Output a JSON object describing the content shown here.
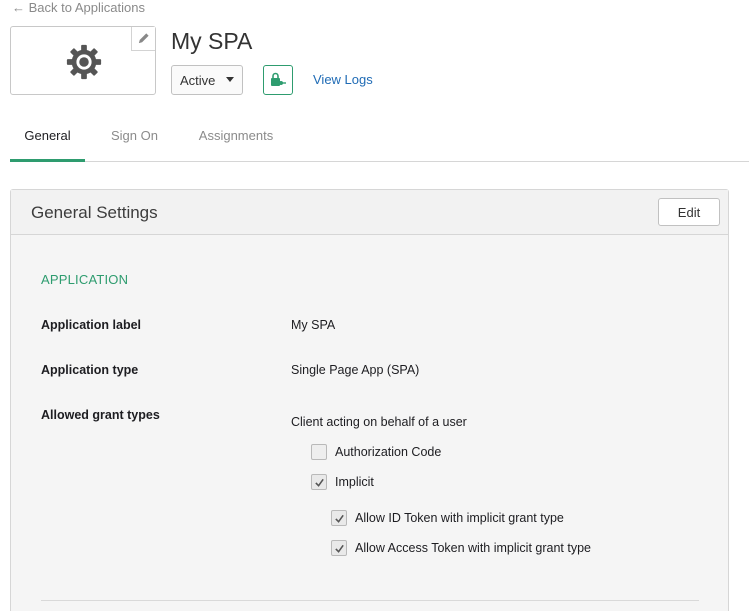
{
  "nav": {
    "back_label": "← Back to Applications"
  },
  "app": {
    "title": "My SPA",
    "status": "Active",
    "view_logs_label": "View Logs"
  },
  "tabs": [
    {
      "label": "General",
      "active": true
    },
    {
      "label": "Sign On",
      "active": false
    },
    {
      "label": "Assignments",
      "active": false
    }
  ],
  "panel": {
    "title": "General Settings",
    "edit_label": "Edit",
    "section_title": "APPLICATION",
    "fields": [
      {
        "label": "Application label",
        "value": "My SPA"
      },
      {
        "label": "Application type",
        "value": "Single Page App (SPA)"
      },
      {
        "label": "Allowed grant types",
        "value": "Client acting on behalf of a user"
      }
    ],
    "grant_types": [
      {
        "label": "Authorization Code",
        "checked": false
      },
      {
        "label": "Implicit",
        "checked": true
      }
    ],
    "implicit_options": [
      {
        "label": "Allow ID Token with implicit grant type",
        "checked": true
      },
      {
        "label": "Allow Access Token with implicit grant type",
        "checked": true
      }
    ]
  },
  "colors": {
    "accent": "#2e9c6f",
    "link": "#1f6bb5",
    "muted": "#8b8b8b",
    "panel_bg": "#f5f5f5"
  }
}
